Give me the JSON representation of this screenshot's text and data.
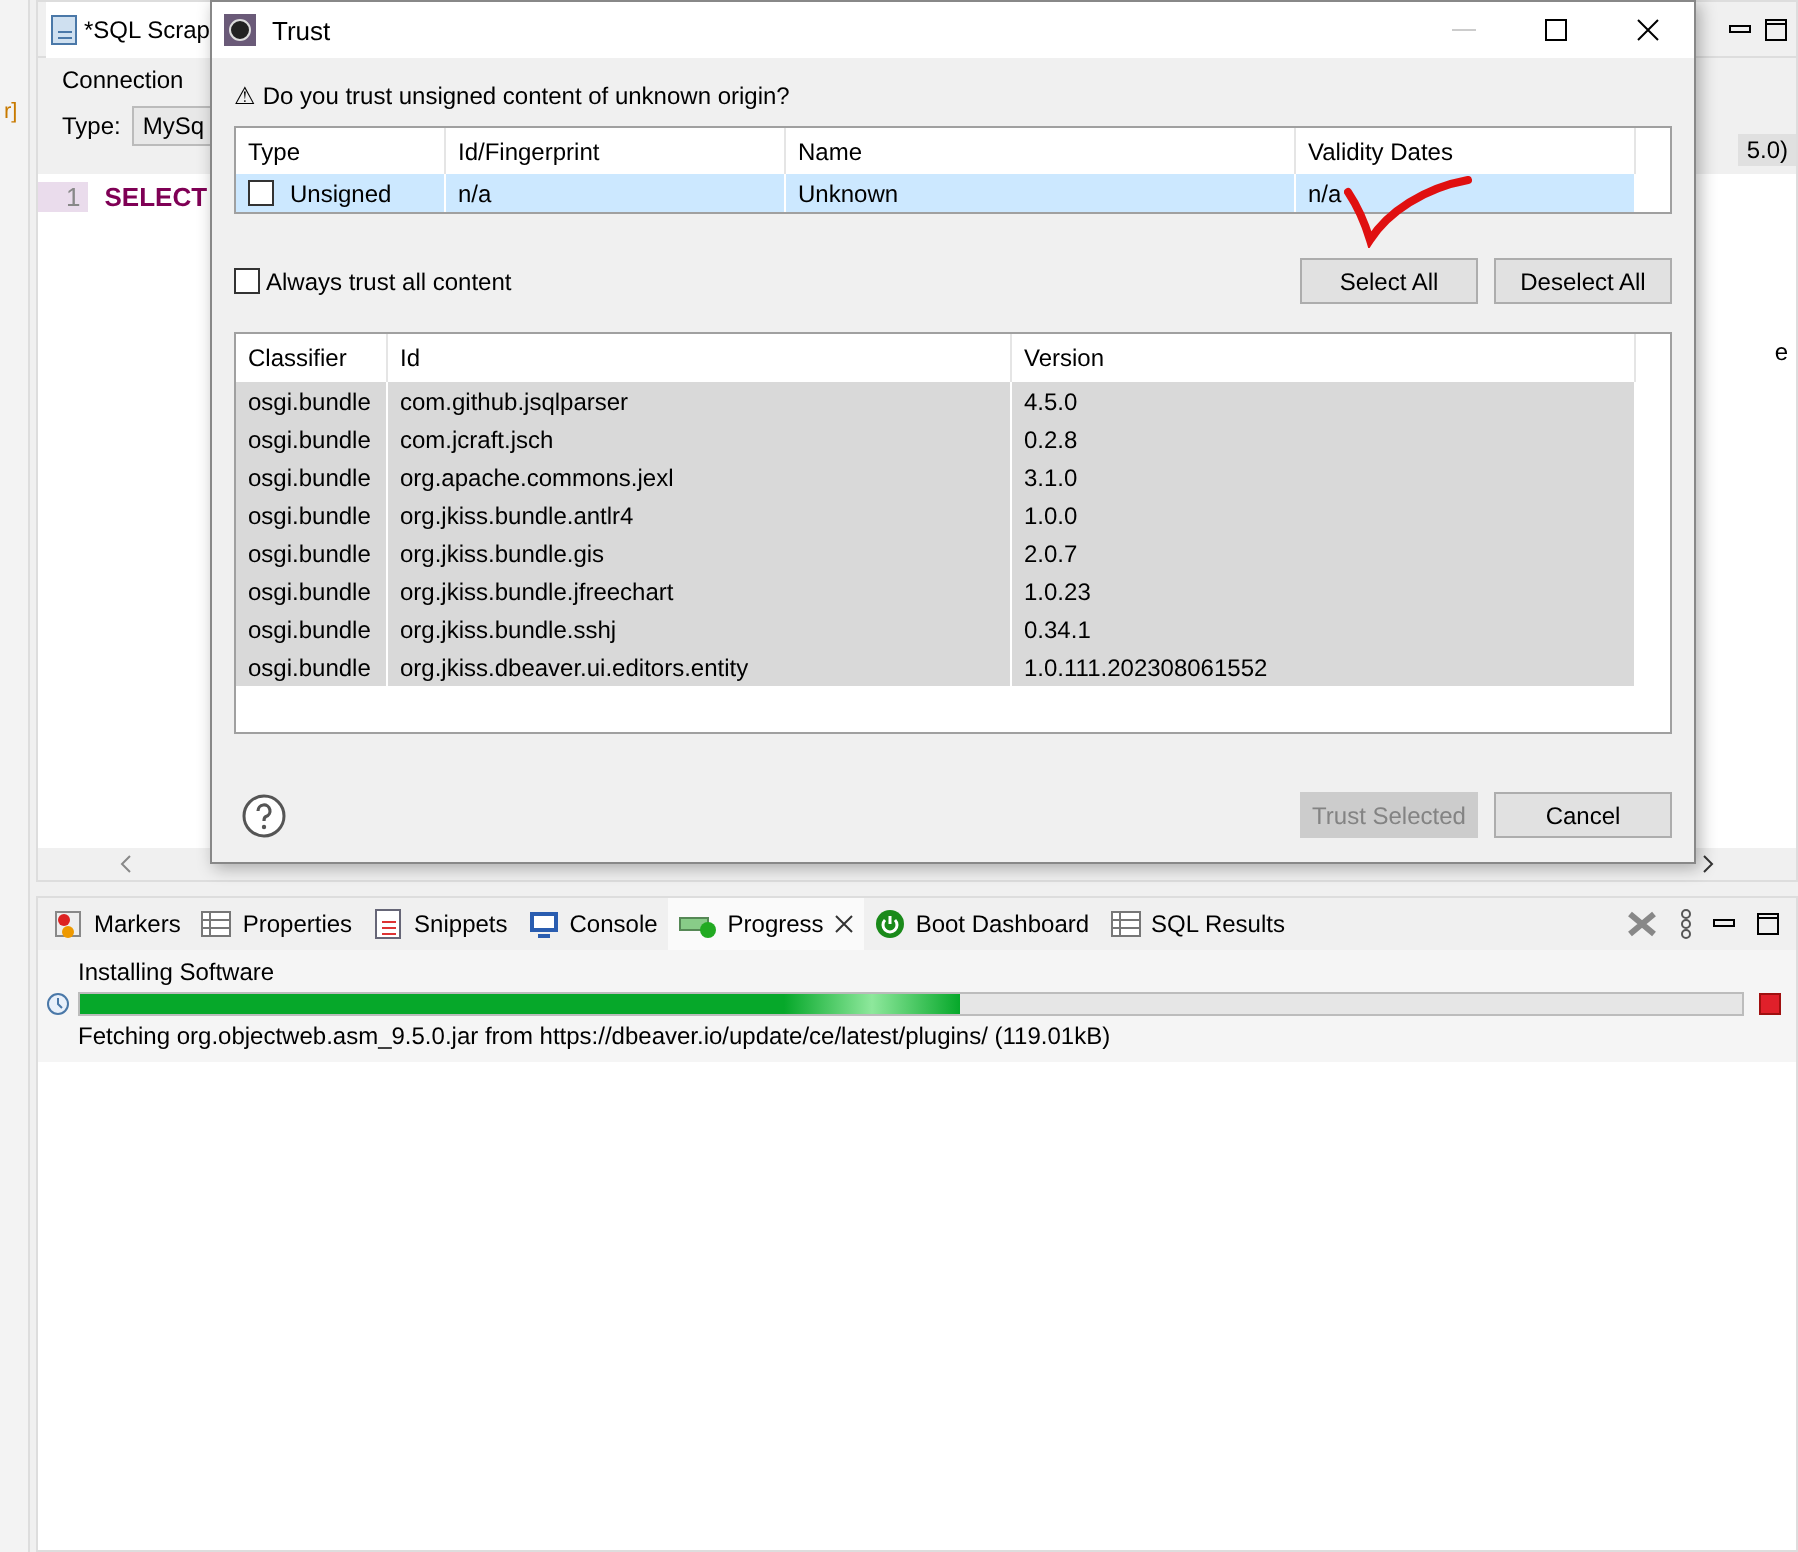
{
  "editor": {
    "tab_title": "*SQL Scrap",
    "connection_label": "Connection",
    "type_label": "Type:",
    "type_value": "MySq",
    "line_number": "1",
    "code": "SELECT",
    "side_text": "r]",
    "right_fragment": "5.0)",
    "right_letter": "e"
  },
  "dialog": {
    "title": "Trust",
    "warning_glyph": "⚠",
    "question": "Do you trust unsigned content of unknown origin?",
    "certificates": {
      "columns": [
        "Type",
        "Id/Fingerprint",
        "Name",
        "Validity Dates"
      ],
      "rows": [
        {
          "type": "Unsigned",
          "checked": false,
          "selected": true,
          "id": "n/a",
          "name": "Unknown",
          "validity": "n/a"
        }
      ]
    },
    "always_trust": {
      "label": "Always trust all content",
      "checked": false
    },
    "select_buttons": [
      "Select All",
      "Deselect All"
    ],
    "units": {
      "columns": [
        "Classifier",
        "Id",
        "Version"
      ],
      "rows": [
        {
          "classifier": "osgi.bundle",
          "id": "com.github.jsqlparser",
          "version": "4.5.0",
          "selected": true
        },
        {
          "classifier": "osgi.bundle",
          "id": "com.jcraft.jsch",
          "version": "0.2.8",
          "selected": true
        },
        {
          "classifier": "osgi.bundle",
          "id": "org.apache.commons.jexl",
          "version": "3.1.0",
          "selected": true
        },
        {
          "classifier": "osgi.bundle",
          "id": "org.jkiss.bundle.antlr4",
          "version": "1.0.0",
          "selected": true
        },
        {
          "classifier": "osgi.bundle",
          "id": "org.jkiss.bundle.gis",
          "version": "2.0.7",
          "selected": true
        },
        {
          "classifier": "osgi.bundle",
          "id": "org.jkiss.bundle.jfreechart",
          "version": "1.0.23",
          "selected": true
        },
        {
          "classifier": "osgi.bundle",
          "id": "org.jkiss.bundle.sshj",
          "version": "0.34.1",
          "selected": true
        },
        {
          "classifier": "osgi.bundle",
          "id": "org.jkiss.dbeaver.ui.editors.entity",
          "version": "1.0.111.202308061552",
          "selected": true
        }
      ]
    },
    "footer_buttons": [
      {
        "label": "Trust Selected",
        "disabled": true
      },
      {
        "label": "Cancel",
        "disabled": false
      }
    ]
  },
  "bottom_panel": {
    "tabs": [
      {
        "label": "Markers",
        "kind": "markers",
        "selected": false
      },
      {
        "label": "Properties",
        "kind": "properties",
        "selected": false
      },
      {
        "label": "Snippets",
        "kind": "snippets",
        "selected": false
      },
      {
        "label": "Console",
        "kind": "console",
        "selected": false
      },
      {
        "label": "Progress",
        "kind": "progress",
        "selected": true
      },
      {
        "label": "Boot Dashboard",
        "kind": "boot",
        "selected": false
      },
      {
        "label": "SQL Results",
        "kind": "results",
        "selected": false
      }
    ],
    "progress": {
      "title": "Installing Software",
      "level": 0.53,
      "status": "Fetching org.objectweb.asm_9.5.0.jar from https://dbeaver.io/update/ce/latest/plugins/ (119.01kB)"
    }
  }
}
